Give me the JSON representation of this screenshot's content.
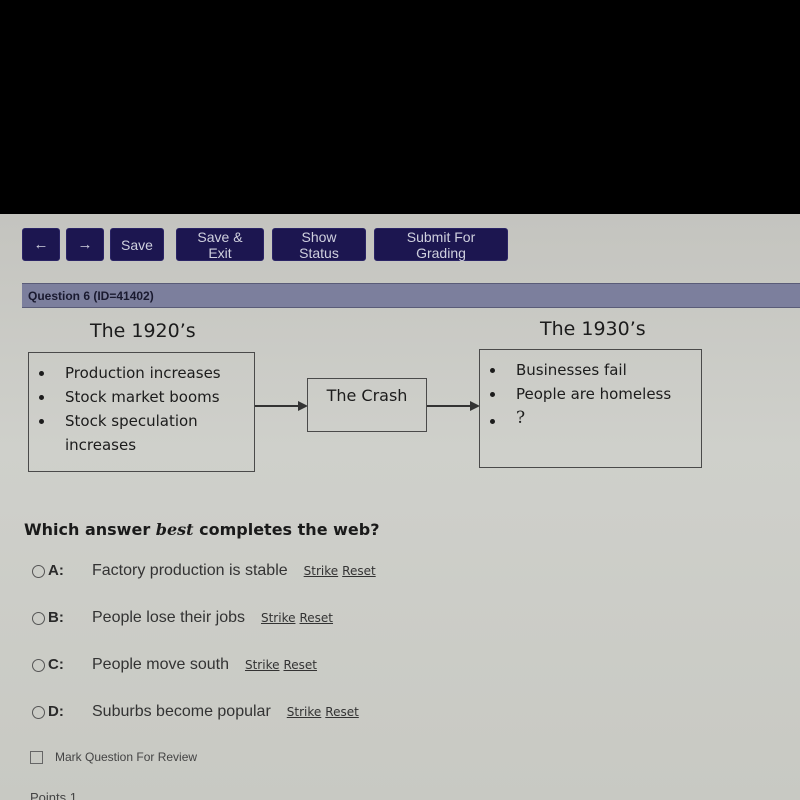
{
  "toolbar": {
    "back_icon": "←",
    "forward_icon": "→",
    "save_label": "Save",
    "save_exit_label": "Save & Exit",
    "show_status_label": "Show Status",
    "submit_label": "Submit For Grading"
  },
  "question": {
    "header": "Question 6 (ID=41402)",
    "diagram": {
      "left_title": "The 1920’s",
      "left_items": [
        "Production increases",
        "Stock market booms",
        "Stock speculation increases"
      ],
      "middle_label": "The Crash",
      "right_title": "The 1930’s",
      "right_items": [
        "Businesses fail",
        "People are homeless",
        "?"
      ]
    },
    "prompt_before": "Which answer ",
    "prompt_emphasis": "best",
    "prompt_after": " completes the web?",
    "options": [
      {
        "letter": "A:",
        "text": "Factory production is stable",
        "strike": "Strike",
        "reset": "Reset"
      },
      {
        "letter": "B:",
        "text": "People lose their jobs",
        "strike": "Strike",
        "reset": "Reset"
      },
      {
        "letter": "C:",
        "text": "People move south",
        "strike": "Strike",
        "reset": "Reset"
      },
      {
        "letter": "D:",
        "text": "Suburbs become popular",
        "strike": "Strike",
        "reset": "Reset"
      }
    ],
    "mark_review_label": "Mark Question For Review",
    "points_label": "Points 1"
  },
  "colors": {
    "button_bg": "#1c1650",
    "header_bar": "#7c7f9d"
  }
}
